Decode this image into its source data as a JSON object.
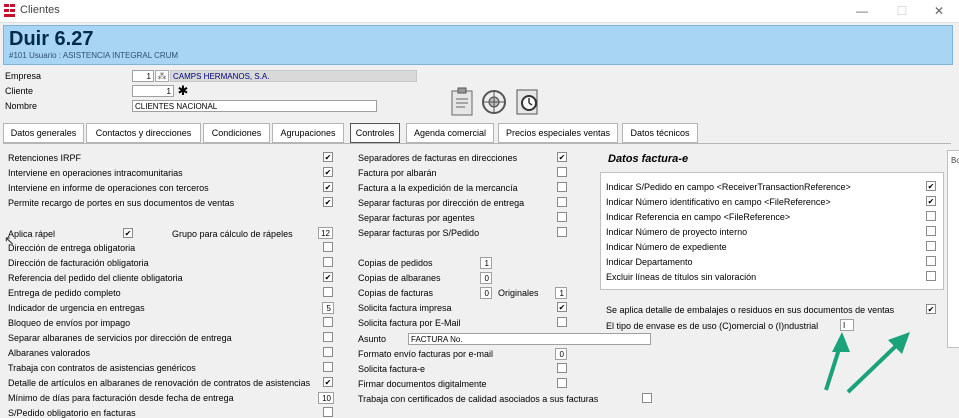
{
  "window": {
    "title": "Clientes",
    "controls": [
      "—",
      "☐",
      "✕"
    ]
  },
  "header": {
    "title": "Duir 6.27",
    "subtitle": "#101 Usuario : ASISTENCIA INTEGRAL CRUM"
  },
  "fields": {
    "empresa_label": "Empresa",
    "empresa_value": "1",
    "empresa_name": "CAMPS HERMANOS, S.A.",
    "cliente_label": "Cliente",
    "cliente_value": "1",
    "nombre_label": "Nombre",
    "nombre_value": "CLIENTES NACIONAL"
  },
  "tabs": [
    {
      "label": "Datos generales"
    },
    {
      "label": "Contactos y direcciones"
    },
    {
      "label": "Condiciones"
    },
    {
      "label": "Agrupaciones"
    },
    {
      "label": "Controles",
      "active": true
    },
    {
      "label": "Agenda comercial"
    },
    {
      "label": "Precios especiales ventas"
    },
    {
      "label": "Datos técnicos"
    }
  ],
  "col1": [
    {
      "label": "Retenciones IRPF",
      "checked": true
    },
    {
      "label": "Interviene en operaciones intracomunitarias",
      "checked": true
    },
    {
      "label": "Interviene en informe de operaciones con terceros",
      "checked": true
    },
    {
      "label": "Permite recargo de portes en sus documentos de ventas",
      "checked": true
    }
  ],
  "aplica_rapel": {
    "label": "Aplica rápel",
    "checked": true,
    "grupo_label": "Grupo para cálculo de rápeles",
    "grupo_value": "12"
  },
  "col1b": [
    {
      "label": "Dirección de entrega obligatoria",
      "checked": false
    },
    {
      "label": "Dirección de facturación obligatoria",
      "checked": false
    },
    {
      "label": "Referencia del pedido del cliente obligatoria",
      "checked": true
    },
    {
      "label": "Entrega de pedido completo",
      "checked": false
    },
    {
      "label": "Indicador de urgencia en entregas",
      "value": "5"
    },
    {
      "label": "Bloqueo de envíos por impago",
      "checked": false
    },
    {
      "label": "Separar albaranes de servicios por dirección de entrega",
      "checked": false
    },
    {
      "label": "Albaranes valorados",
      "checked": false
    },
    {
      "label": "Trabaja con contratos de asistencias genéricos",
      "checked": false
    },
    {
      "label": "Detalle de artículos en albaranes de renovación de contratos de asistencias",
      "checked": true
    },
    {
      "label": "Mínimo de días para facturación desde fecha de entrega",
      "value": "10"
    },
    {
      "label": "S/Pedido obligatorio en facturas",
      "checked": false
    }
  ],
  "col2": [
    {
      "label": "Separadores de facturas en direcciones",
      "checked": true
    },
    {
      "label": "Factura por albarán",
      "checked": false
    },
    {
      "label": "Factura a la expedición de la mercancía",
      "checked": false
    },
    {
      "label": "Separar facturas por dirección de entrega",
      "checked": false
    },
    {
      "label": "Separar facturas por agentes",
      "checked": false
    },
    {
      "label": "Separar facturas por S/Pedido",
      "checked": false
    }
  ],
  "col2b": {
    "copias_pedidos_label": "Copias de pedidos",
    "copias_pedidos": "1",
    "copias_albaranes_label": "Copias de albaranes",
    "copias_albaranes": "0",
    "copias_facturas_label": "Copias de facturas",
    "copias_facturas": "0",
    "originales_label": "Originales",
    "originales": "1",
    "solicita_impresa_label": "Solicita factura impresa",
    "solicita_impresa": true,
    "solicita_email_label": "Solicita factura por E-Mail",
    "solicita_email": false,
    "asunto_label": "Asunto",
    "asunto_value": "FACTURA No.",
    "formato_label": "Formato envío facturas por e-mail",
    "formato_value": "0",
    "factura_e_label": "Solicita factura-e",
    "factura_e": false,
    "firmar_label": "Firmar documentos digitalmente",
    "firmar": false,
    "certificados_label": "Trabaja con certificados de calidad asociados a sus facturas",
    "certificados": false
  },
  "factura_e": {
    "title": "Datos factura-e",
    "items": [
      {
        "label": "Indicar S/Pedido en campo <ReceiverTransactionReference>",
        "checked": true
      },
      {
        "label": "Indicar Número identificativo en campo <FileReference>",
        "checked": true
      },
      {
        "label": "Indicar Referencia en campo <FileReference>",
        "checked": false
      },
      {
        "label": "Indicar Número de proyecto interno",
        "checked": false
      },
      {
        "label": "Indicar Número de expediente",
        "checked": false
      },
      {
        "label": "Indicar Departamento",
        "checked": false
      },
      {
        "label": "Excluir líneas de títulos sin valoración",
        "checked": false
      }
    ],
    "embalajes_label": "Se aplica detalle de embalajes o residuos en sus documentos de ventas",
    "embalajes": true,
    "envase_label": "El tipo de envase es de uso (C)omercial o (I)ndustrial",
    "envase_value": "I"
  },
  "right_fragment": {
    "label": "Bo"
  },
  "colors": {
    "header_bg": "#a9d5f4",
    "arrow": "#1aa37a"
  }
}
